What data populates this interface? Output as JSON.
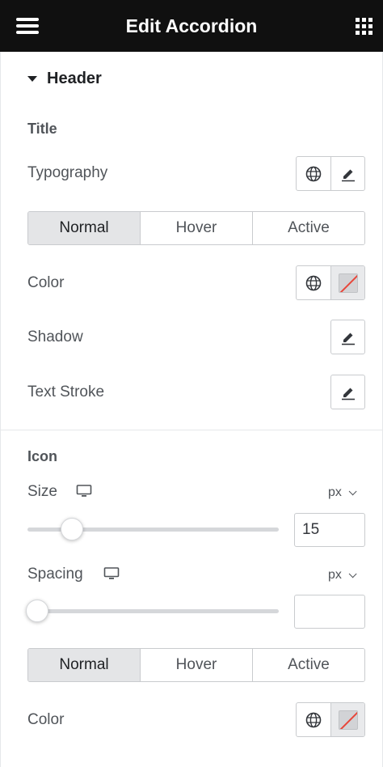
{
  "header": {
    "title": "Edit Accordion",
    "menu_icon": "hamburger-menu-icon",
    "apps_icon": "grid-apps-icon"
  },
  "section": {
    "label": "Header",
    "toggle_icon": "caret-down-icon"
  },
  "title_group": {
    "heading": "Title",
    "typography_label": "Typography",
    "tabs": [
      "Normal",
      "Hover",
      "Active"
    ],
    "active_tab": "Normal",
    "color_label": "Color",
    "shadow_label": "Shadow",
    "text_stroke_label": "Text Stroke"
  },
  "icon_group": {
    "heading": "Icon",
    "size_label": "Size",
    "size_unit": "px",
    "size_value": "15",
    "size_slider_fraction": 0.15,
    "spacing_label": "Spacing",
    "spacing_unit": "px",
    "spacing_value": "",
    "spacing_slider_fraction": 0,
    "tabs": [
      "Normal",
      "Hover",
      "Active"
    ],
    "active_tab": "Normal",
    "color_label": "Color"
  },
  "colors": {
    "topbar": "#101010",
    "active_tab": "#e4e5e7",
    "swatch_slash": "#e8463a"
  }
}
